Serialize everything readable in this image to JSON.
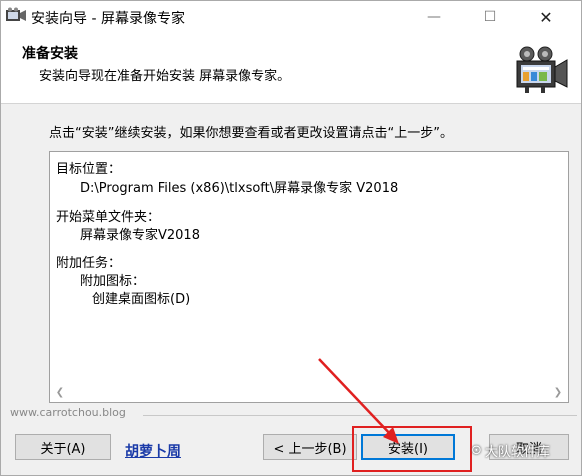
{
  "window": {
    "title": "安装向导 - 屏幕录像专家",
    "min_glyph": "—",
    "max_glyph": "☐",
    "close_glyph": "✕"
  },
  "header": {
    "title": "准备安装",
    "subtitle": "安装向导现在准备开始安装 屏幕录像专家。"
  },
  "instruction": "点击“安装”继续安装，如果你想要查看或者更改设置请点击“上一步”。",
  "memo": {
    "dest_label": "目标位置：",
    "dest_value": "D:\\Program Files (x86)\\tlxsoft\\屏幕录像专家 V2018",
    "menu_label": "开始菜单文件夹：",
    "menu_value": "屏幕录像专家V2018",
    "tasks_label": "附加任务：",
    "tasks_sub": "附加图标：",
    "tasks_item": "创建桌面图标(D)"
  },
  "watermark_url": "www.carrotchou.blog",
  "author_link": "胡萝卜周",
  "buttons": {
    "about": "关于(A)",
    "back": "< 上一步(B)",
    "install": "安装(I)",
    "cancel": "取消"
  },
  "overlay_watermark": "大队软件库",
  "accent_colors": {
    "highlight": "#e02020",
    "focus": "#0078d7",
    "link": "#1a3aa8"
  }
}
